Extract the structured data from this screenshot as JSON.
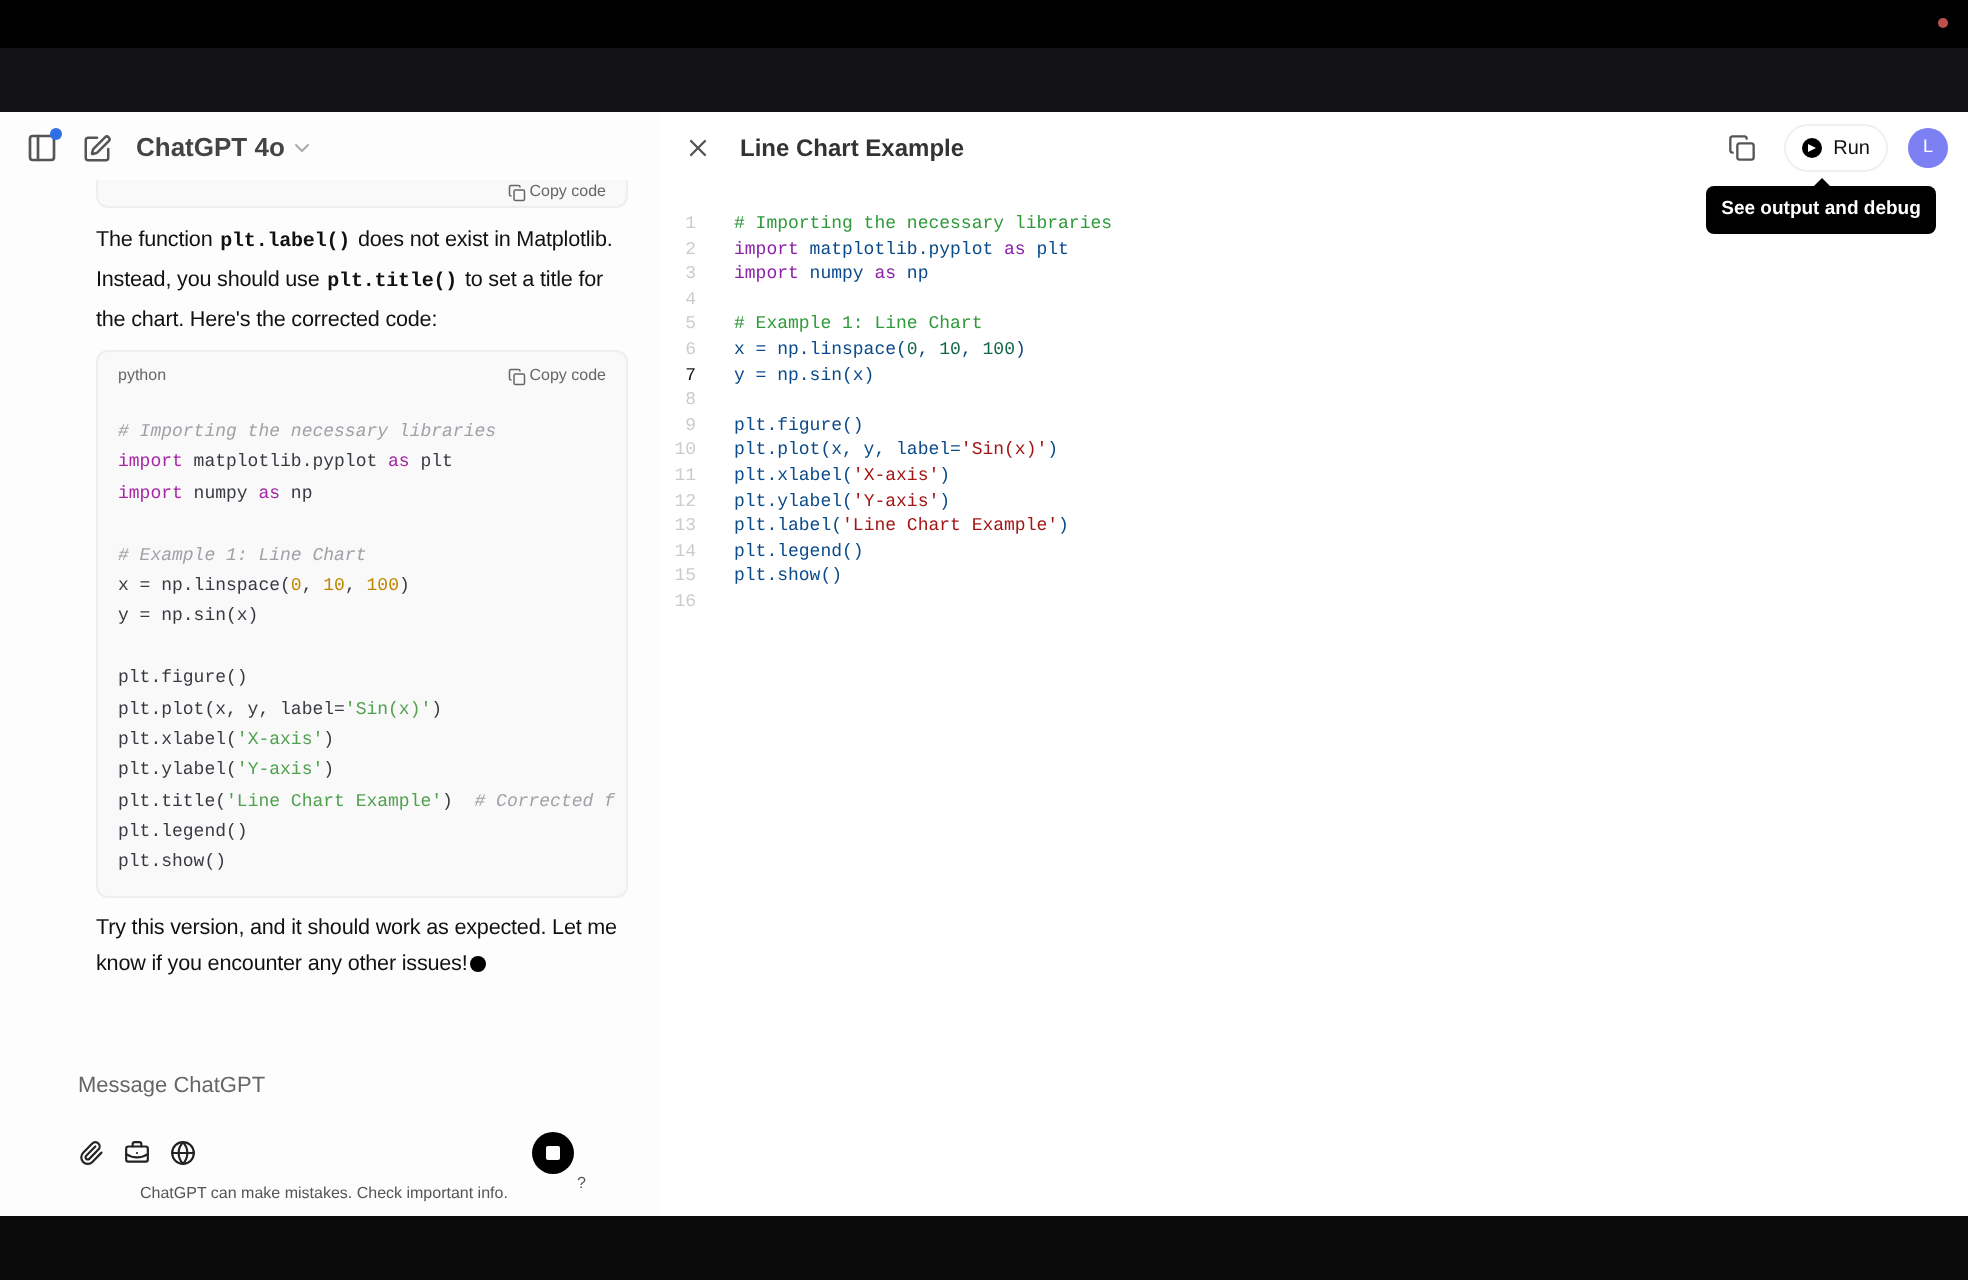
{
  "chat_header": {
    "title": "ChatGPT 4o",
    "sidebar_notification": true
  },
  "chat": {
    "prev_block_copy": "Copy code",
    "message_1": [
      {
        "kind": "text",
        "text": "The function "
      },
      {
        "kind": "code",
        "text": "plt.label()"
      },
      {
        "kind": "text",
        "text": " does not exist in Matplotlib. Instead, you should use "
      },
      {
        "kind": "code",
        "text": "plt.title()"
      },
      {
        "kind": "text",
        "text": " to set a title for the chart. Here's the corrected code:"
      }
    ],
    "code_block": {
      "language": "python",
      "copy": "Copy code",
      "groups": [
        [
          {
            "tokens": [
              {
                "kind": "comment",
                "text": "# Importing the necessary libraries"
              }
            ]
          },
          {
            "tokens": [
              {
                "kind": "keyword",
                "text": "import"
              },
              {
                "kind": "plain",
                "text": " matplotlib.pyplot "
              },
              {
                "kind": "keyword",
                "text": "as"
              },
              {
                "kind": "plain",
                "text": " plt"
              }
            ]
          },
          {
            "tokens": [
              {
                "kind": "keyword",
                "text": "import"
              },
              {
                "kind": "plain",
                "text": " numpy "
              },
              {
                "kind": "keyword",
                "text": "as"
              },
              {
                "kind": "plain",
                "text": " np"
              }
            ]
          }
        ],
        [
          {
            "tokens": [
              {
                "kind": "comment",
                "text": "# Example 1: Line Chart"
              }
            ]
          },
          {
            "tokens": [
              {
                "kind": "plain",
                "text": "x = np.linspace("
              },
              {
                "kind": "number",
                "text": "0"
              },
              {
                "kind": "plain",
                "text": ", "
              },
              {
                "kind": "number",
                "text": "10"
              },
              {
                "kind": "plain",
                "text": ", "
              },
              {
                "kind": "number",
                "text": "100"
              },
              {
                "kind": "plain",
                "text": ")"
              }
            ]
          },
          {
            "tokens": [
              {
                "kind": "plain",
                "text": "y = np.sin(x)"
              }
            ]
          }
        ],
        [
          {
            "tokens": [
              {
                "kind": "plain",
                "text": "plt.figure()"
              }
            ]
          },
          {
            "tokens": [
              {
                "kind": "plain",
                "text": "plt.plot(x, y, label="
              },
              {
                "kind": "string",
                "text": "'Sin(x)'"
              },
              {
                "kind": "plain",
                "text": ")"
              }
            ]
          },
          {
            "tokens": [
              {
                "kind": "plain",
                "text": "plt.xlabel("
              },
              {
                "kind": "string",
                "text": "'X-axis'"
              },
              {
                "kind": "plain",
                "text": ")"
              }
            ]
          },
          {
            "tokens": [
              {
                "kind": "plain",
                "text": "plt.ylabel("
              },
              {
                "kind": "string",
                "text": "'Y-axis'"
              },
              {
                "kind": "plain",
                "text": ")"
              }
            ]
          },
          {
            "tokens": [
              {
                "kind": "plain",
                "text": "plt.title("
              },
              {
                "kind": "string",
                "text": "'Line Chart Example'"
              },
              {
                "kind": "plain",
                "text": ")  "
              },
              {
                "kind": "comment",
                "text": "# Corrected f"
              }
            ]
          },
          {
            "tokens": [
              {
                "kind": "plain",
                "text": "plt.legend()"
              }
            ]
          },
          {
            "tokens": [
              {
                "kind": "plain",
                "text": "plt.show()"
              }
            ]
          }
        ]
      ]
    },
    "message_2": "Try this version, and it should work as expected. Let me know if you encounter any other issues!"
  },
  "composer": {
    "placeholder": "Message ChatGPT",
    "help": "?",
    "disclaimer": "ChatGPT can make mistakes. Check important info."
  },
  "canvas": {
    "title": "Line Chart Example",
    "run": "Run",
    "tooltip": "See output and debug",
    "avatar": "L",
    "lines": [
      {
        "number": "1",
        "current": false,
        "tokens": [
          {
            "kind": "comment",
            "text": "# Importing the necessary libraries"
          }
        ]
      },
      {
        "number": "2",
        "current": false,
        "tokens": [
          {
            "kind": "keyword",
            "text": "import"
          },
          {
            "kind": "plain",
            "text": " matplotlib.pyplot "
          },
          {
            "kind": "keyword",
            "text": "as"
          },
          {
            "kind": "plain",
            "text": " plt"
          }
        ]
      },
      {
        "number": "3",
        "current": false,
        "tokens": [
          {
            "kind": "keyword",
            "text": "import"
          },
          {
            "kind": "plain",
            "text": " numpy "
          },
          {
            "kind": "keyword",
            "text": "as"
          },
          {
            "kind": "plain",
            "text": " np"
          }
        ]
      },
      {
        "number": "4",
        "current": false
      },
      {
        "number": "5",
        "current": false,
        "tokens": [
          {
            "kind": "comment",
            "text": "# Example 1: Line Chart"
          }
        ]
      },
      {
        "number": "6",
        "current": false,
        "tokens": [
          {
            "kind": "plain",
            "text": "x = np.linspace("
          },
          {
            "kind": "number",
            "text": "0"
          },
          {
            "kind": "plain",
            "text": ", "
          },
          {
            "kind": "number",
            "text": "10"
          },
          {
            "kind": "plain",
            "text": ", "
          },
          {
            "kind": "number",
            "text": "100"
          },
          {
            "kind": "plain",
            "text": ")"
          }
        ]
      },
      {
        "number": "7",
        "current": true,
        "tokens": [
          {
            "kind": "plain",
            "text": "y = np.sin(x)"
          }
        ]
      },
      {
        "number": "8",
        "current": false
      },
      {
        "number": "9",
        "current": false,
        "tokens": [
          {
            "kind": "plain",
            "text": "plt.figure()"
          }
        ]
      },
      {
        "number": "10",
        "current": false,
        "tokens": [
          {
            "kind": "plain",
            "text": "plt.plot(x, y, label="
          },
          {
            "kind": "string",
            "text": "'Sin(x)'"
          },
          {
            "kind": "plain",
            "text": ")"
          }
        ]
      },
      {
        "number": "11",
        "current": false,
        "tokens": [
          {
            "kind": "plain",
            "text": "plt.xlabel("
          },
          {
            "kind": "string",
            "text": "'X-axis'"
          },
          {
            "kind": "plain",
            "text": ")"
          }
        ]
      },
      {
        "number": "12",
        "current": false,
        "tokens": [
          {
            "kind": "plain",
            "text": "plt.ylabel("
          },
          {
            "kind": "string",
            "text": "'Y-axis'"
          },
          {
            "kind": "plain",
            "text": ")"
          }
        ]
      },
      {
        "number": "13",
        "current": false,
        "tokens": [
          {
            "kind": "plain",
            "text": "plt.label("
          },
          {
            "kind": "string",
            "text": "'Line Chart Example'"
          },
          {
            "kind": "plain",
            "text": ")"
          }
        ]
      },
      {
        "number": "14",
        "current": false,
        "tokens": [
          {
            "kind": "plain",
            "text": "plt.legend()"
          }
        ]
      },
      {
        "number": "15",
        "current": false,
        "tokens": [
          {
            "kind": "plain",
            "text": "plt.show()"
          }
        ]
      },
      {
        "number": "16",
        "current": false
      }
    ]
  }
}
